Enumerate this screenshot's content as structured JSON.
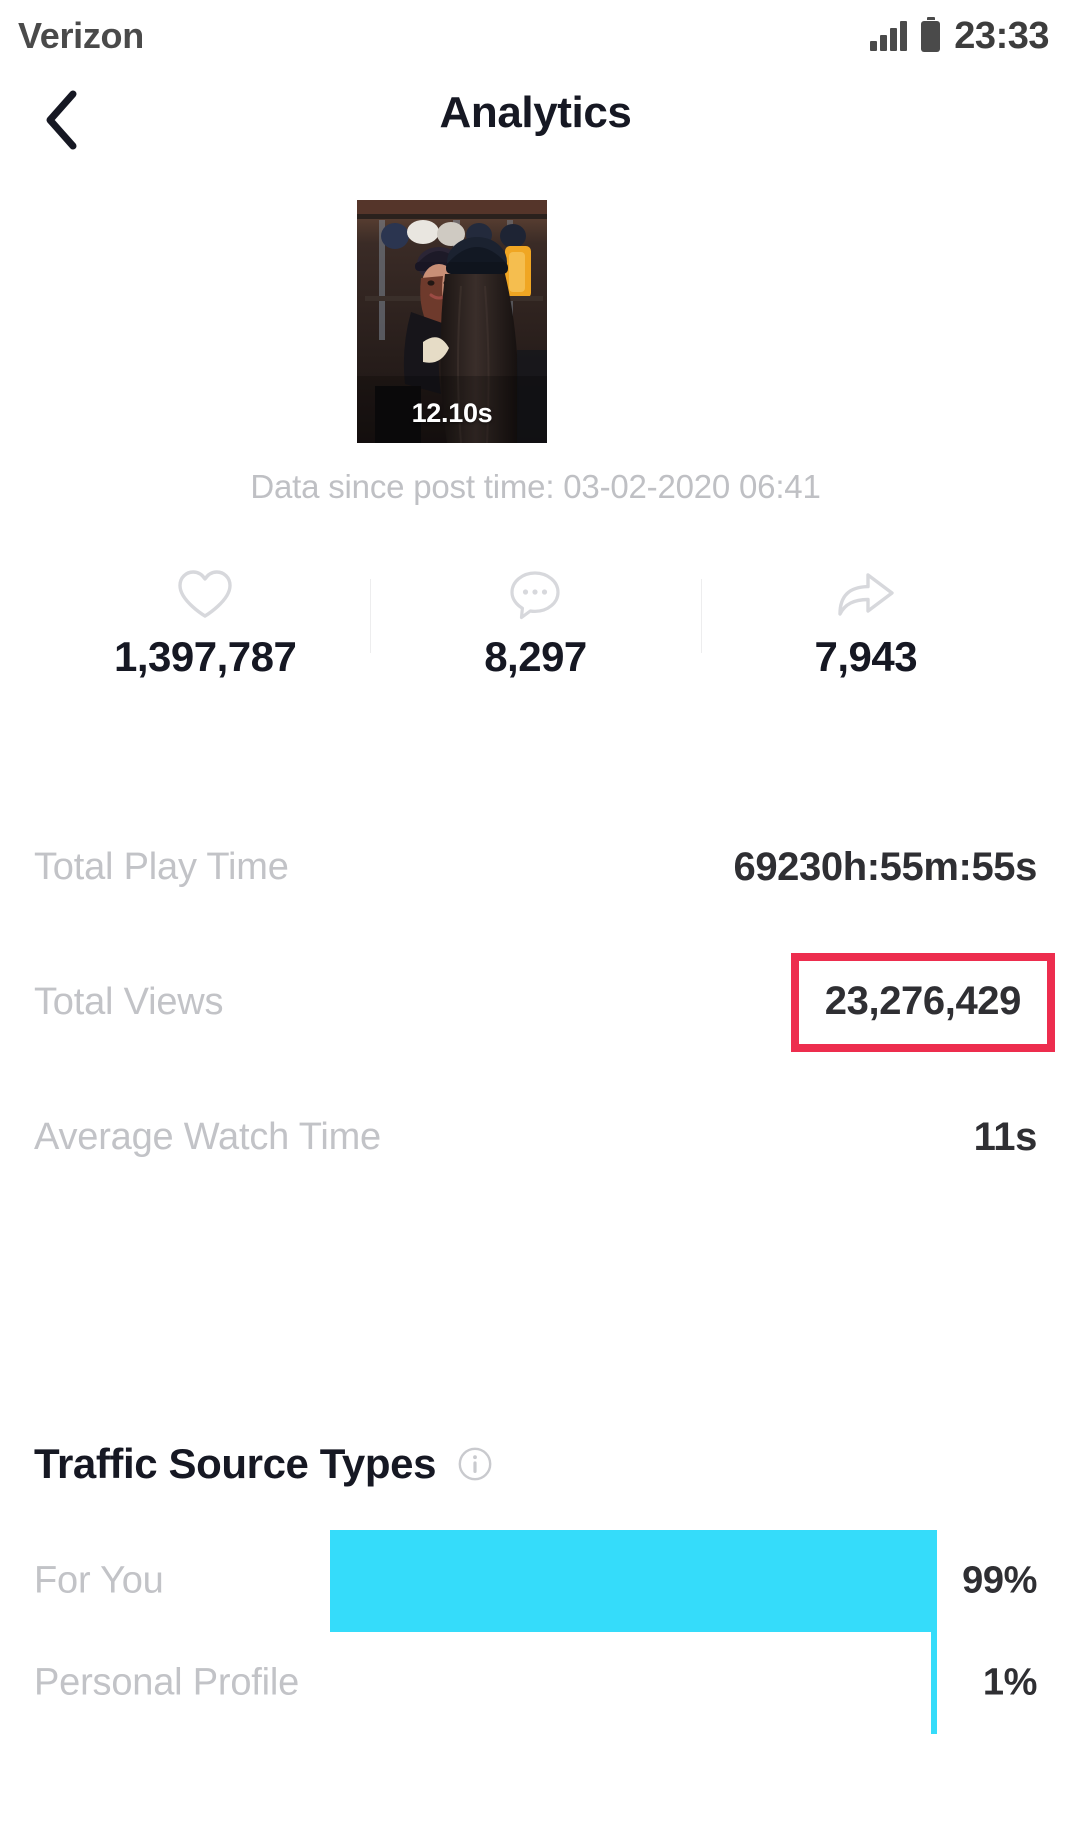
{
  "status_bar": {
    "carrier": "Verizon",
    "time": "23:33",
    "signal_icon": "signal-bars-icon",
    "battery_icon": "battery-icon"
  },
  "nav": {
    "back_icon": "chevron-left-icon",
    "title": "Analytics"
  },
  "video": {
    "duration": "12.10s",
    "thumbnail_alt": "video-thumbnail"
  },
  "since_line": "Data since post time: 03-02-2020 06:41",
  "stats": [
    {
      "icon": "heart-icon",
      "value": "1,397,787"
    },
    {
      "icon": "comment-icon",
      "value": "8,297"
    },
    {
      "icon": "share-icon",
      "value": "7,943"
    }
  ],
  "metrics": [
    {
      "label": "Total Play Time",
      "value": "69230h:55m:55s",
      "highlighted": false
    },
    {
      "label": "Total Views",
      "value": "23,276,429",
      "highlighted": true
    },
    {
      "label": "Average Watch Time",
      "value": "11s",
      "highlighted": false
    }
  ],
  "traffic": {
    "title": "Traffic Source Types",
    "info_icon": "info-circle-icon"
  },
  "colors": {
    "bar": "#35dcfa",
    "highlight": "#ed2d4e",
    "label": "#c2c3c7",
    "value": "#2f2f33"
  },
  "chart_data": {
    "type": "bar",
    "title": "Traffic Source Types",
    "orientation": "horizontal",
    "categories": [
      "For You",
      "Personal Profile"
    ],
    "values": [
      99,
      1
    ],
    "value_labels": [
      "99%",
      "1%"
    ],
    "unit": "%",
    "xlim": [
      0,
      100
    ],
    "xlabel": "",
    "ylabel": "",
    "grid": false,
    "legend": false,
    "series_color": "#35dcfa",
    "bars_right_aligned": true
  }
}
